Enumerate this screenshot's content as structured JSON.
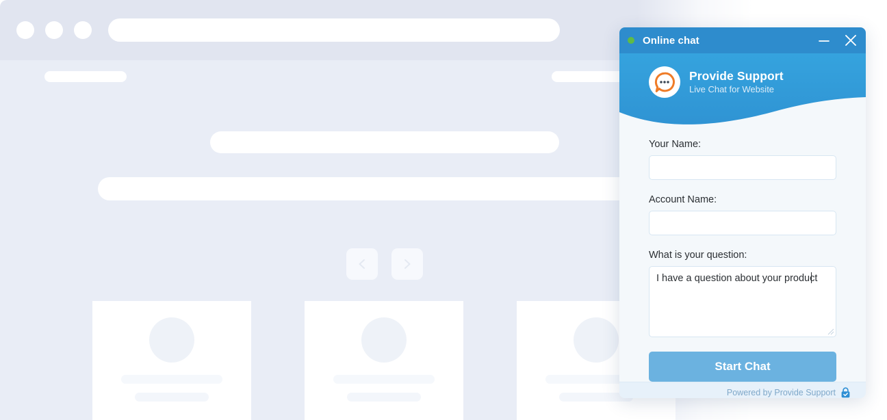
{
  "background_page": {
    "browser_dots": [
      "dot-1",
      "dot-2",
      "dot-3"
    ],
    "url_bar_placeholder": "",
    "carousel": {
      "prev_icon": "chevron-left-icon",
      "next_icon": "chevron-right-icon"
    },
    "cards": [
      {
        "avatar_icon": "avatar-placeholder-circle"
      },
      {
        "avatar_icon": "avatar-placeholder-circle"
      },
      {
        "avatar_icon": "avatar-placeholder-circle"
      }
    ]
  },
  "chat_widget": {
    "titlebar": {
      "status_icon": "online-status-dot",
      "status_color": "#5fbb46",
      "title": "Online chat",
      "minimize_icon": "minimize-icon",
      "close_icon": "close-icon",
      "background_color": "#2e8ccd"
    },
    "brand": {
      "logo_icon": "provide-support-speech-bubble-logo",
      "name": "Provide Support",
      "tagline": "Live Chat for Website",
      "logo_accent_color": "#ef7c28",
      "header_color": "#35a3de"
    },
    "form": {
      "name_label": "Your Name:",
      "name_value": "",
      "name_placeholder": "",
      "account_label": "Account Name:",
      "account_value": "",
      "account_placeholder": "",
      "question_label": "What is your question:",
      "question_value": "I have a question about your product",
      "question_placeholder": "",
      "submit_label": "Start Chat",
      "submit_color": "#6bb2e0",
      "resize_icon": "resize-grip-icon"
    },
    "footer": {
      "text": "Powered by Provide Support",
      "badge_icon": "secure-lock-check-icon",
      "badge_color": "#2f8fd4",
      "background_color": "#e7f1fa"
    }
  }
}
